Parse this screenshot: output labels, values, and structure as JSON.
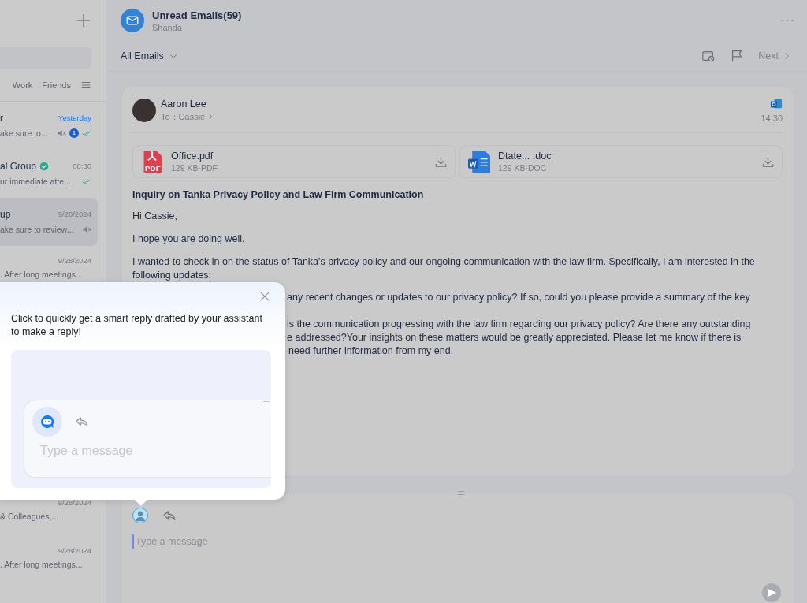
{
  "sidebar": {
    "tabs": [
      {
        "label": "Work",
        "selected": false
      },
      {
        "label": "Friends",
        "selected": false
      }
    ],
    "items": [
      {
        "title": "r",
        "date": "Yesterday",
        "highlight_date": true,
        "preview": "ake sure to...",
        "muted": true,
        "badge": "1",
        "read": true,
        "verified": false,
        "selected": false
      },
      {
        "title": "al Group",
        "date": "08:30",
        "highlight_date": false,
        "preview": "ur immediate atte...",
        "muted": false,
        "read": true,
        "verified": true,
        "selected": false
      },
      {
        "title": "up",
        "date": "9/28/2024",
        "highlight_date": false,
        "preview": "ake sure to review...",
        "muted": true,
        "read": false,
        "verified": false,
        "selected": true
      },
      {
        "date": "9/28/2024",
        "highlight_date": false,
        "preview": ". After long meetings...",
        "muted": false,
        "read": false,
        "verified": false,
        "selected": false
      },
      {
        "date": "9/28/2024",
        "highlight_date": false,
        "preview": "& Colleagues,...",
        "muted": false,
        "read": false,
        "verified": false,
        "selected": false
      },
      {
        "date": "9/28/2024",
        "highlight_date": false,
        "preview": ". After long meetings...",
        "muted": false,
        "read": false,
        "verified": false,
        "selected": false
      }
    ]
  },
  "header": {
    "title": "Unread Emails(59)",
    "subtitle": "Shanda"
  },
  "filter": {
    "label": "All Emails",
    "next": "Next"
  },
  "email": {
    "sender": "Aaron Lee",
    "to": "To：Cassie",
    "time": "14:30",
    "attachments": [
      {
        "kind": "pdf",
        "icon_label": "PDF",
        "name": "Office.pdf",
        "meta": "129 KB·PDF"
      },
      {
        "kind": "doc",
        "name": "Dtate... .doc",
        "meta": "129 KB·DOC"
      }
    ],
    "subject": "Inquiry on Tanka Privacy Policy and Law Firm Communication",
    "paragraphs": [
      "Hi Cassie,",
      "I hope you are doing well.",
      "I wanted to check in on the status of Tanka's privacy policy and our ongoing communication with the law firm. Specifically, I am interested in the following updates:"
    ],
    "partial_lines": [
      "any recent changes or updates to our privacy policy? If so, could you please provide a summary of the key",
      "is the communication progressing with the law firm regarding our privacy policy? Are there any outstanding",
      "e addressed?Your insights on these matters would be greatly appreciated. Please let me know if there is",
      "need further information from my end."
    ]
  },
  "composer": {
    "placeholder": "Type a message"
  },
  "tip": {
    "text": "Click to quickly get a smart reply drafted by your assistant to make a reply!",
    "placeholder": "Type a message"
  }
}
